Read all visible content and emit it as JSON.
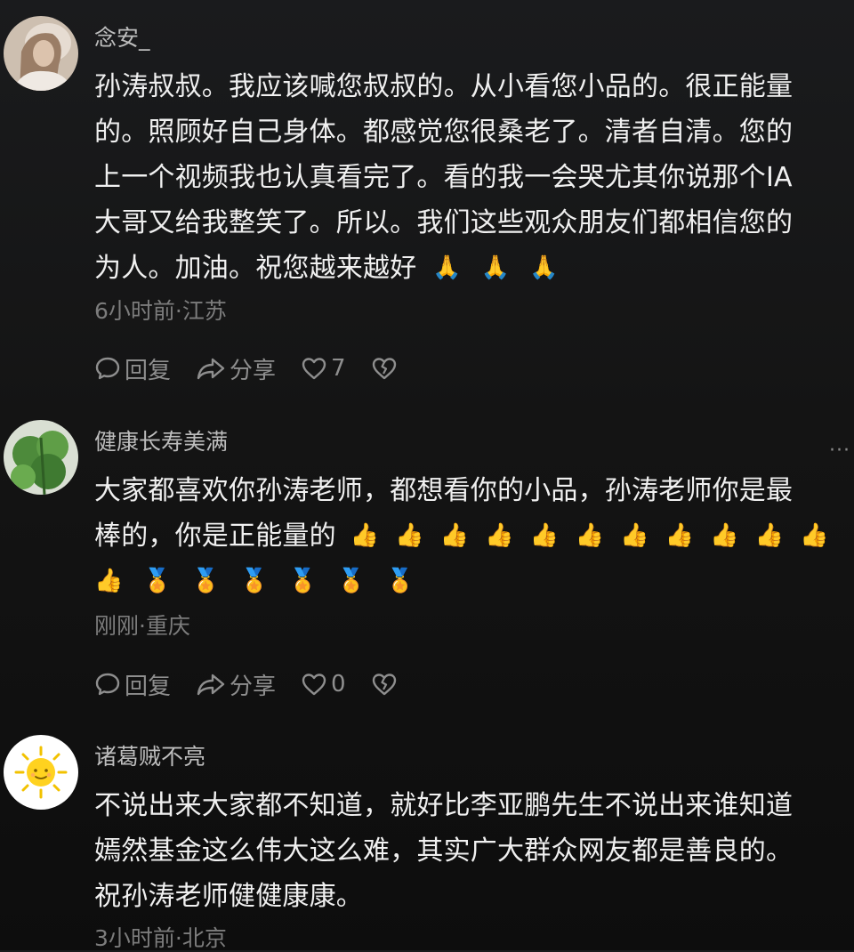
{
  "comments": [
    {
      "username": "念安_",
      "lines": [
        "孙涛叔叔。我应该喊您叔叔的。从小看您小品的。很正能量",
        "的。照顾好自己身体。都感觉您很桑老了。清者自清。您的",
        "上一个视频我也认真看完了。看的我一会哭尤其你说那个IA",
        "大哥又给我整笑了。所以。我们这些观众朋友们都相信您的",
        "为人。加油。祝您越来越好"
      ],
      "emojis": [
        "🙏",
        "🙏",
        "🙏"
      ],
      "meta": "6小时前·江苏",
      "reply_label": "回复",
      "share_label": "分享",
      "like_count": "7"
    },
    {
      "username": "健康长寿美满",
      "lines": [
        "大家都喜欢你孙涛老师，都想看你的小品，孙涛老师你是最",
        "棒的，你是正能量的"
      ],
      "emoji_line_1": [
        "👍",
        "👍",
        "👍",
        "👍",
        "👍",
        "👍",
        "👍",
        "👍",
        "👍",
        "👍",
        "👍"
      ],
      "emoji_line_2": [
        "👍",
        "🏅",
        "🏅",
        "🏅",
        "🏅",
        "🏅",
        "🏅"
      ],
      "meta": "刚刚·重庆",
      "reply_label": "回复",
      "share_label": "分享",
      "like_count": "0",
      "more": "···"
    },
    {
      "username": "诸葛贼不亮",
      "lines": [
        "不说出来大家都不知道，就好比李亚鹏先生不说出来谁知道",
        "嫣然基金这么伟大这么难，其实广大群众网友都是善良的。",
        "祝孙涛老师健健康康。"
      ],
      "meta": "3小时前·北京"
    }
  ],
  "colors": {
    "background": "#141414",
    "text": "#f0f0f0",
    "username": "#bdbdbd",
    "meta": "#7c7c7c",
    "icon": "#8e8e8e"
  }
}
